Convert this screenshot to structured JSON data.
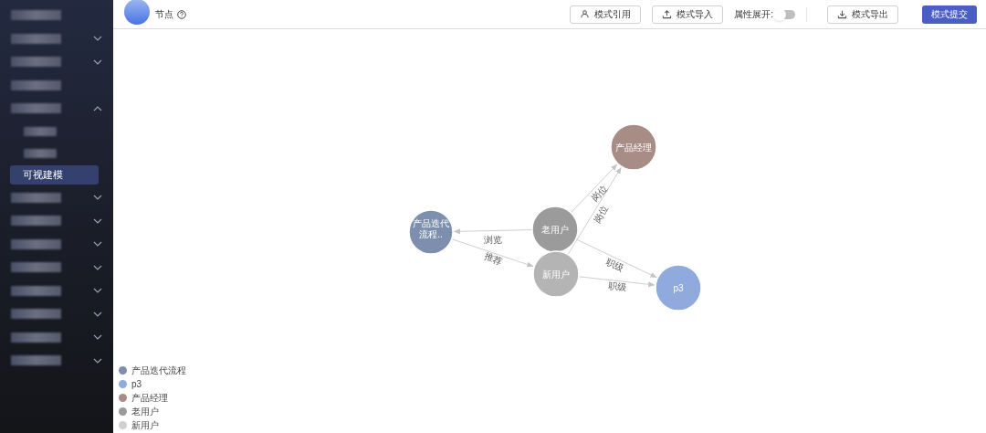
{
  "sidebar": {
    "items": [
      {
        "kind": "leaf"
      },
      {
        "kind": "group",
        "expanded": false
      },
      {
        "kind": "group",
        "expanded": false
      },
      {
        "kind": "leaf"
      },
      {
        "kind": "group",
        "expanded": true,
        "children": [
          {
            "selected": false
          },
          {
            "selected": false
          },
          {
            "label": "可视建模",
            "selected": true
          }
        ]
      },
      {
        "kind": "group",
        "expanded": false
      },
      {
        "kind": "group",
        "expanded": false
      },
      {
        "kind": "group",
        "expanded": false
      },
      {
        "kind": "group",
        "expanded": false
      },
      {
        "kind": "group",
        "expanded": false
      },
      {
        "kind": "group",
        "expanded": false
      },
      {
        "kind": "group",
        "expanded": false
      },
      {
        "kind": "group",
        "expanded": false
      }
    ]
  },
  "toolbar": {
    "title": "节点",
    "buttons": [
      {
        "kind": "outline",
        "label": "模式引用"
      },
      {
        "kind": "outline",
        "label": "模式导入"
      },
      {
        "kind": "toggle",
        "label": "属性展开:",
        "on": false
      },
      {
        "kind": "outline",
        "label": "模式导出"
      },
      {
        "kind": "primary",
        "label": "模式提交"
      }
    ]
  },
  "graph": {
    "nodes": [
      {
        "label": "产品迭代流程..",
        "color": "#7d8fad"
      },
      {
        "label": "老用户",
        "color": "#9b9b9b"
      },
      {
        "label": "新用户",
        "color": "#b4b4b4"
      },
      {
        "label": "产品经理",
        "color": "#a88d87"
      },
      {
        "label": "p3",
        "color": "#90aadd"
      }
    ],
    "edges": [
      {
        "label": "浏览"
      },
      {
        "label": "推荐"
      },
      {
        "label": "岗位"
      },
      {
        "label": "岗位"
      },
      {
        "label": "职级"
      },
      {
        "label": "职级"
      }
    ]
  },
  "legend": [
    {
      "label": "产品迭代流程",
      "color": "#7d8fad"
    },
    {
      "label": "p3",
      "color": "#90aadd"
    },
    {
      "label": "产品经理",
      "color": "#a88d87"
    },
    {
      "label": "老用户",
      "color": "#9b9b9b"
    },
    {
      "label": "新用户",
      "color": "#d0d0d0"
    }
  ]
}
